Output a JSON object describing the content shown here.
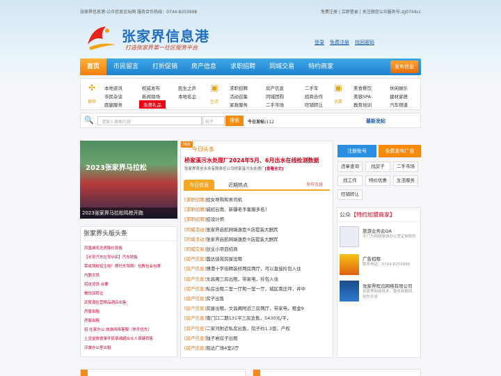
{
  "topbar": {
    "left": "张家界信息港-公众信息论坛网 服务合作热线：0744-8203998",
    "right": "免费注册 | 立即登录 | 关注微信公众服务号:zjj0744cc"
  },
  "logo": {
    "name": "张家界信息港",
    "slogan": "打造张家界第一社区服务平台"
  },
  "user_links": [
    "登录",
    "免费注册",
    "找回密码"
  ],
  "nav": {
    "items": [
      "首页",
      "市民留言",
      "打折促销",
      "房产信息",
      "求职招聘",
      "同城交易",
      "特约商家"
    ],
    "publish": "发布信息"
  },
  "categories": {
    "g1": {
      "icon_label": "推荐",
      "icon": "sparkle-icon",
      "links": [
        "本地资讯",
        "权威发布",
        "民生之声",
        "市民杂谈",
        "新闻现场",
        "本地名企",
        "跑腿服务",
        "免费礼品"
      ]
    },
    "g2": {
      "icon_label": "生活",
      "icon": "bag-icon",
      "links": [
        "求职招聘",
        "房产信息",
        "二手车",
        "活动召集",
        "同城团购",
        "招商合作",
        "家政服务",
        "二手市场",
        "旺铺转让"
      ]
    },
    "g3": {
      "icon_label": "优惠",
      "icon": "bag-icon",
      "links": [
        "美食餐饮",
        "休闲娱乐",
        "美容SPA",
        "建材家居",
        "教育培训",
        "汽车频道"
      ]
    }
  },
  "search": {
    "placeholder": "请输入搜索内容",
    "category": "帖子",
    "button": "搜索",
    "today_label": "今日发帖:",
    "today_count": "112",
    "new_post": "最新发帖"
  },
  "photo": {
    "banner": "2023张家界马拉松",
    "caption": "2023张家界马拉松鸣枪开跑"
  },
  "headlines_box": {
    "title": "张家界头版头条",
    "items": [
      "凤凰城毛坯房降价急售",
      "【长安汽车拉安Vi店】汽车销售",
      "荣成驾校招生啦！摩托车驾照！包教包会包拿",
      "内勤文员",
      "招送货员·合要",
      "餐饮店转让",
      "武陵源住营精品酒店出售",
      "房屋出租",
      "房屋出租",
      "招·在家办公·旅游网络客服（熟手优先）",
      "土豆堂旅馆事件民宿湘超合伙人保健转售",
      "凉露办公室出租"
    ]
  },
  "news": {
    "hot": "Hot",
    "title": "今日头条",
    "headline": "桥家溪污水处理厂2024年5月、6月出水在线检测数据",
    "summary": "张家界首创水务有限责任公司桥家溪污水处理厂",
    "more": "[查看全文]",
    "tabs": [
      "今日信息",
      "近期热点",
      "发布信息"
    ],
    "list": [
      {
        "tag": "[求职招聘]",
        "text": "招女导购和男司机"
      },
      {
        "tag": "[求职招聘]",
        "text": "诚招云南、新疆老手客服多名！"
      },
      {
        "tag": "[求职招聘]",
        "text": "招设计师"
      },
      {
        "tag": "[同城活动]",
        "text": "张家界启航网端逸臣⑤店提装大酬宾"
      },
      {
        "tag": "[同城活动]",
        "text": "张家界启航网端逸臣⑤店提装大酬宾"
      },
      {
        "tag": "[同城交易]",
        "text": "创业小项目招商"
      },
      {
        "tag": "[房产信息]",
        "text": "盛达佳苑房屋出租"
      },
      {
        "tag": "[房产信息]",
        "text": "博港十字街精装修两房两厅，可以直接拎包入住"
      },
      {
        "tag": "[房产信息]",
        "text": "文昌阁三房出租，带家电，拎包入住"
      },
      {
        "tag": "[房产信息]",
        "text": "私房出租二室一厅和一室一厅，城区南庄坪，井中"
      },
      {
        "tag": "[房产信息]",
        "text": "房子出售"
      },
      {
        "tag": "[房产信息]",
        "text": "房屋出租，文昌阁附近三房两厅，带家电，租金9"
      },
      {
        "tag": "[房产信息]",
        "text": "南门口二期131平三房急售，5430元/平，"
      },
      {
        "tag": "[房产信息]",
        "text": "二家河附近私房出售，院子约1.3亩，产权"
      },
      {
        "tag": "[房产信息]",
        "text": "独子岩房子出租"
      },
      {
        "tag": "[房产信息]",
        "text": "屈达广场4室2厅"
      }
    ]
  },
  "right": {
    "register": "注册账号",
    "free_post": "免费发布广告",
    "quick": [
      "违章查询",
      "找房子",
      "二手市场",
      "找工作",
      "特价优惠",
      "生活服务",
      "旺铺转让"
    ],
    "box_title_a": "公众",
    "box_title_b": "【特约加盟商家】",
    "ads": [
      {
        "title": "旅游业务云OA",
        "desc": "专门为网络旅游办公室定制软件"
      },
      {
        "title": "广告招租",
        "desc": "联系电话：0744-8203998"
      },
      {
        "title": "张家界程迅网络有限公司",
        "desc": "张家界网络技术，服务新颖网，软件开发"
      }
    ]
  },
  "colors": {
    "nav_blue": "#1d83cf",
    "orange": "#f28a1c",
    "red": "#d4001a"
  }
}
